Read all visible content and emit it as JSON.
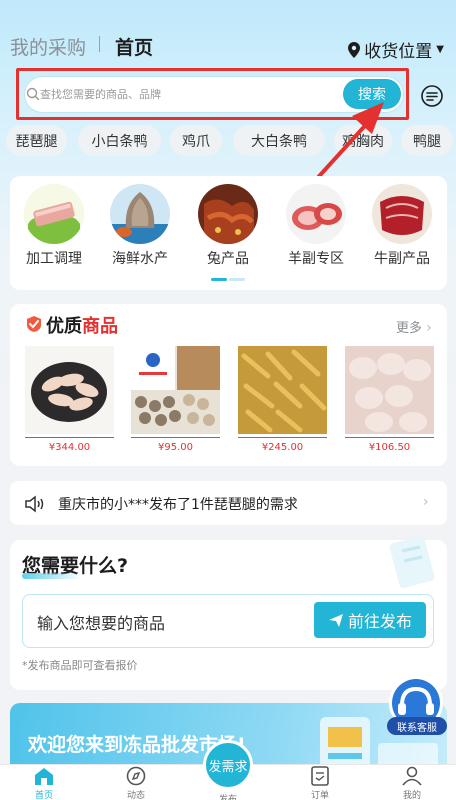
{
  "header": {
    "tab_purchase": "我的采购",
    "tab_home": "首页",
    "location_label": "收货位置"
  },
  "search": {
    "placeholder": "查找您需要的商品、品牌",
    "button_label": "搜索"
  },
  "tags": [
    "琵琶腿",
    "小白条鸭",
    "鸡爪",
    "大白条鸭",
    "鸡胸肉",
    "鸭腿"
  ],
  "categories": [
    {
      "label": "加工调理"
    },
    {
      "label": "海鲜水产"
    },
    {
      "label": "兔产品"
    },
    {
      "label": "羊副专区"
    },
    {
      "label": "牛副产品"
    }
  ],
  "quality": {
    "title_black": "优质",
    "title_red": "商品",
    "more_label": "更多",
    "products": [
      {
        "price": "¥344.00"
      },
      {
        "price": "¥95.00"
      },
      {
        "price": "¥245.00"
      },
      {
        "price": "¥106.50"
      }
    ]
  },
  "notice": {
    "text": "重庆市的小***发布了1件琵琶腿的需求"
  },
  "need": {
    "title": "您需要什么?",
    "input_placeholder": "输入您想要的商品",
    "publish_label": "前往发布",
    "hint": "*发布商品即可查看报价"
  },
  "banner": {
    "text": "欢迎您来到冻品批发市场!"
  },
  "service": {
    "label": "联系客服"
  },
  "nav": {
    "home": "首页",
    "dynamic": "动态",
    "fab": "发需求",
    "publish": "发布",
    "orders": "订单",
    "mine": "我的"
  },
  "colors": {
    "accent": "#22b5d6",
    "red": "#e4312f"
  }
}
